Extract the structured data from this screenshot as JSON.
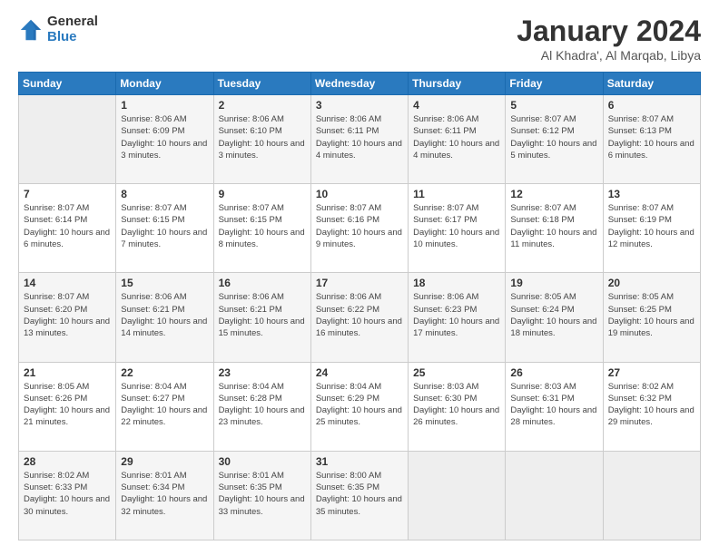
{
  "header": {
    "logo_general": "General",
    "logo_blue": "Blue",
    "title": "January 2024",
    "location": "Al Khadra', Al Marqab, Libya"
  },
  "weekdays": [
    "Sunday",
    "Monday",
    "Tuesday",
    "Wednesday",
    "Thursday",
    "Friday",
    "Saturday"
  ],
  "weeks": [
    [
      {
        "day": "",
        "info": ""
      },
      {
        "day": "1",
        "info": "Sunrise: 8:06 AM\nSunset: 6:09 PM\nDaylight: 10 hours\nand 3 minutes."
      },
      {
        "day": "2",
        "info": "Sunrise: 8:06 AM\nSunset: 6:10 PM\nDaylight: 10 hours\nand 3 minutes."
      },
      {
        "day": "3",
        "info": "Sunrise: 8:06 AM\nSunset: 6:11 PM\nDaylight: 10 hours\nand 4 minutes."
      },
      {
        "day": "4",
        "info": "Sunrise: 8:06 AM\nSunset: 6:11 PM\nDaylight: 10 hours\nand 4 minutes."
      },
      {
        "day": "5",
        "info": "Sunrise: 8:07 AM\nSunset: 6:12 PM\nDaylight: 10 hours\nand 5 minutes."
      },
      {
        "day": "6",
        "info": "Sunrise: 8:07 AM\nSunset: 6:13 PM\nDaylight: 10 hours\nand 6 minutes."
      }
    ],
    [
      {
        "day": "7",
        "info": "Sunrise: 8:07 AM\nSunset: 6:14 PM\nDaylight: 10 hours\nand 6 minutes."
      },
      {
        "day": "8",
        "info": "Sunrise: 8:07 AM\nSunset: 6:15 PM\nDaylight: 10 hours\nand 7 minutes."
      },
      {
        "day": "9",
        "info": "Sunrise: 8:07 AM\nSunset: 6:15 PM\nDaylight: 10 hours\nand 8 minutes."
      },
      {
        "day": "10",
        "info": "Sunrise: 8:07 AM\nSunset: 6:16 PM\nDaylight: 10 hours\nand 9 minutes."
      },
      {
        "day": "11",
        "info": "Sunrise: 8:07 AM\nSunset: 6:17 PM\nDaylight: 10 hours\nand 10 minutes."
      },
      {
        "day": "12",
        "info": "Sunrise: 8:07 AM\nSunset: 6:18 PM\nDaylight: 10 hours\nand 11 minutes."
      },
      {
        "day": "13",
        "info": "Sunrise: 8:07 AM\nSunset: 6:19 PM\nDaylight: 10 hours\nand 12 minutes."
      }
    ],
    [
      {
        "day": "14",
        "info": "Sunrise: 8:07 AM\nSunset: 6:20 PM\nDaylight: 10 hours\nand 13 minutes."
      },
      {
        "day": "15",
        "info": "Sunrise: 8:06 AM\nSunset: 6:21 PM\nDaylight: 10 hours\nand 14 minutes."
      },
      {
        "day": "16",
        "info": "Sunrise: 8:06 AM\nSunset: 6:21 PM\nDaylight: 10 hours\nand 15 minutes."
      },
      {
        "day": "17",
        "info": "Sunrise: 8:06 AM\nSunset: 6:22 PM\nDaylight: 10 hours\nand 16 minutes."
      },
      {
        "day": "18",
        "info": "Sunrise: 8:06 AM\nSunset: 6:23 PM\nDaylight: 10 hours\nand 17 minutes."
      },
      {
        "day": "19",
        "info": "Sunrise: 8:05 AM\nSunset: 6:24 PM\nDaylight: 10 hours\nand 18 minutes."
      },
      {
        "day": "20",
        "info": "Sunrise: 8:05 AM\nSunset: 6:25 PM\nDaylight: 10 hours\nand 19 minutes."
      }
    ],
    [
      {
        "day": "21",
        "info": "Sunrise: 8:05 AM\nSunset: 6:26 PM\nDaylight: 10 hours\nand 21 minutes."
      },
      {
        "day": "22",
        "info": "Sunrise: 8:04 AM\nSunset: 6:27 PM\nDaylight: 10 hours\nand 22 minutes."
      },
      {
        "day": "23",
        "info": "Sunrise: 8:04 AM\nSunset: 6:28 PM\nDaylight: 10 hours\nand 23 minutes."
      },
      {
        "day": "24",
        "info": "Sunrise: 8:04 AM\nSunset: 6:29 PM\nDaylight: 10 hours\nand 25 minutes."
      },
      {
        "day": "25",
        "info": "Sunrise: 8:03 AM\nSunset: 6:30 PM\nDaylight: 10 hours\nand 26 minutes."
      },
      {
        "day": "26",
        "info": "Sunrise: 8:03 AM\nSunset: 6:31 PM\nDaylight: 10 hours\nand 28 minutes."
      },
      {
        "day": "27",
        "info": "Sunrise: 8:02 AM\nSunset: 6:32 PM\nDaylight: 10 hours\nand 29 minutes."
      }
    ],
    [
      {
        "day": "28",
        "info": "Sunrise: 8:02 AM\nSunset: 6:33 PM\nDaylight: 10 hours\nand 30 minutes."
      },
      {
        "day": "29",
        "info": "Sunrise: 8:01 AM\nSunset: 6:34 PM\nDaylight: 10 hours\nand 32 minutes."
      },
      {
        "day": "30",
        "info": "Sunrise: 8:01 AM\nSunset: 6:35 PM\nDaylight: 10 hours\nand 33 minutes."
      },
      {
        "day": "31",
        "info": "Sunrise: 8:00 AM\nSunset: 6:35 PM\nDaylight: 10 hours\nand 35 minutes."
      },
      {
        "day": "",
        "info": ""
      },
      {
        "day": "",
        "info": ""
      },
      {
        "day": "",
        "info": ""
      }
    ]
  ]
}
